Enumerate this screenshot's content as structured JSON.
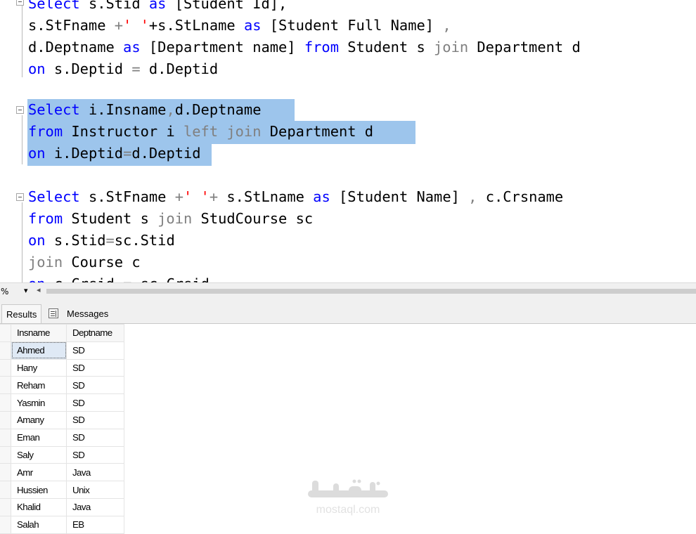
{
  "editor": {
    "queries": [
      {
        "lines": [
          [
            {
              "t": "Select",
              "c": "kw"
            },
            {
              "t": " s.Stid ",
              "c": ""
            },
            {
              "t": "as",
              "c": "kw"
            },
            {
              "t": " [Student Id],",
              "c": ""
            }
          ],
          [
            {
              "t": "s.StFname ",
              "c": ""
            },
            {
              "t": "+",
              "c": "gry"
            },
            {
              "t": "' '",
              "c": "str"
            },
            {
              "t": "+s.StLname ",
              "c": ""
            },
            {
              "t": "as",
              "c": "kw"
            },
            {
              "t": " [Student Full Name] ",
              "c": ""
            },
            {
              "t": ",",
              "c": "gry"
            }
          ],
          [
            {
              "t": "d.Deptname ",
              "c": ""
            },
            {
              "t": "as",
              "c": "kw"
            },
            {
              "t": " [Department name] ",
              "c": ""
            },
            {
              "t": "from",
              "c": "kw"
            },
            {
              "t": " Student s ",
              "c": ""
            },
            {
              "t": "join",
              "c": "gry"
            },
            {
              "t": " Department d",
              "c": ""
            }
          ],
          [
            {
              "t": "on",
              "c": "kw"
            },
            {
              "t": " s.Deptid ",
              "c": ""
            },
            {
              "t": "=",
              "c": "gry"
            },
            {
              "t": " d.Deptid",
              "c": ""
            }
          ]
        ]
      },
      {
        "lines": [
          [
            {
              "t": "Select",
              "c": "kw"
            },
            {
              "t": " i.Insname",
              "c": ""
            },
            {
              "t": ",",
              "c": "gry"
            },
            {
              "t": "d.Deptname",
              "c": ""
            }
          ],
          [
            {
              "t": "from",
              "c": "kw"
            },
            {
              "t": " Instructor i ",
              "c": ""
            },
            {
              "t": "left join",
              "c": "gry"
            },
            {
              "t": " Department d",
              "c": ""
            }
          ],
          [
            {
              "t": "on",
              "c": "kw"
            },
            {
              "t": " i.Deptid",
              "c": ""
            },
            {
              "t": "=",
              "c": "gry"
            },
            {
              "t": "d.Deptid",
              "c": ""
            }
          ]
        ]
      },
      {
        "lines": [
          [
            {
              "t": "Select",
              "c": "kw"
            },
            {
              "t": " s.StFname ",
              "c": ""
            },
            {
              "t": "+",
              "c": "gry"
            },
            {
              "t": "' '",
              "c": "str"
            },
            {
              "t": "+",
              "c": "gry"
            },
            {
              "t": " s.StLname ",
              "c": ""
            },
            {
              "t": "as",
              "c": "kw"
            },
            {
              "t": " [Student Name] ",
              "c": ""
            },
            {
              "t": ",",
              "c": "gry"
            },
            {
              "t": " c.Crsname",
              "c": ""
            }
          ],
          [
            {
              "t": "from",
              "c": "kw"
            },
            {
              "t": " Student s ",
              "c": ""
            },
            {
              "t": "join",
              "c": "gry"
            },
            {
              "t": " StudCourse sc",
              "c": ""
            }
          ],
          [
            {
              "t": "on",
              "c": "kw"
            },
            {
              "t": " s.Stid",
              "c": ""
            },
            {
              "t": "=",
              "c": "gry"
            },
            {
              "t": "sc.Stid",
              "c": ""
            }
          ],
          [
            {
              "t": "join",
              "c": "gry"
            },
            {
              "t": " Course c",
              "c": ""
            }
          ],
          [
            {
              "t": "on",
              "c": "kw"
            },
            {
              "t": " c.Crsid ",
              "c": ""
            },
            {
              "t": "=",
              "c": "gry"
            },
            {
              "t": " sc.Crsid",
              "c": ""
            }
          ]
        ]
      }
    ],
    "colors": {
      "keyword": "#0000ff",
      "string": "#ff0000",
      "operator": "#808080",
      "selection": "#9dc5ec"
    }
  },
  "status": {
    "zoom": "%",
    "zoom_dropdown_icon": "chevron-down-icon",
    "scroll_left_icon": "chevron-left-icon"
  },
  "tabs": {
    "results": "Results",
    "messages": "Messages"
  },
  "grid": {
    "columns": [
      "Insname",
      "Deptname"
    ],
    "rows": [
      [
        "Ahmed",
        "SD"
      ],
      [
        "Hany",
        "SD"
      ],
      [
        "Reham",
        "SD"
      ],
      [
        "Yasmin",
        "SD"
      ],
      [
        "Amany",
        "SD"
      ],
      [
        "Eman",
        "SD"
      ],
      [
        "Saly",
        "SD"
      ],
      [
        "Amr",
        "Java"
      ],
      [
        "Hussien",
        "Unix"
      ],
      [
        "Khalid",
        "Java"
      ],
      [
        "Salah",
        "EB"
      ]
    ]
  },
  "watermark": {
    "text": "mostaql.com"
  }
}
